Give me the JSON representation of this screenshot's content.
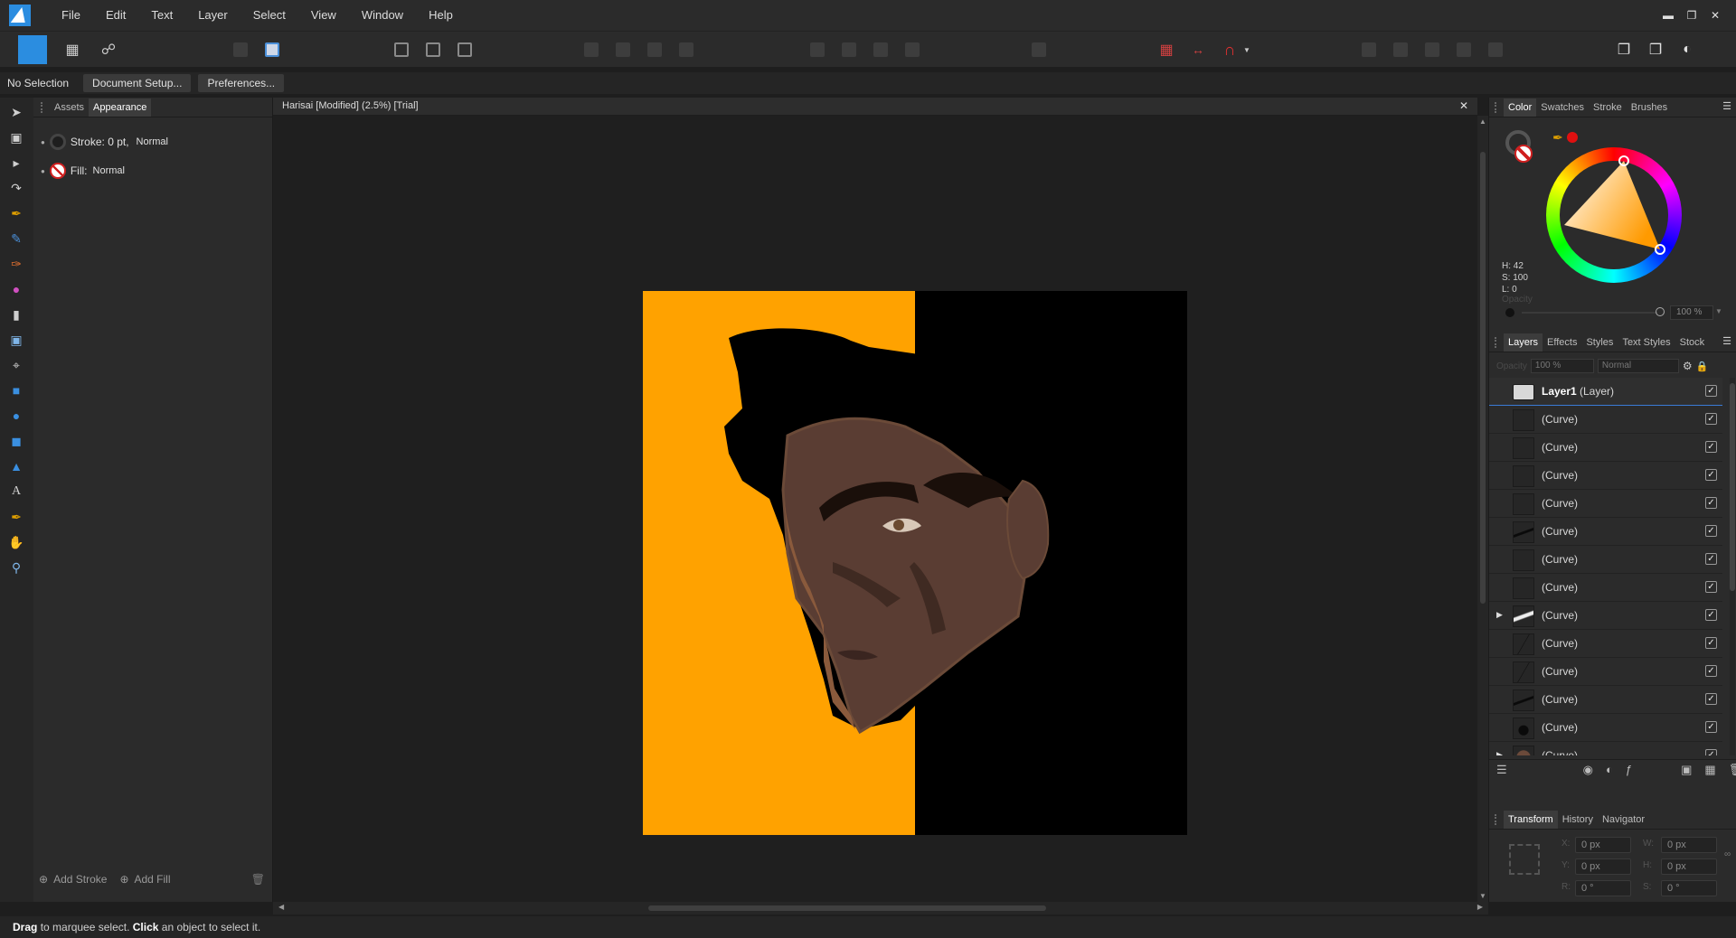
{
  "menubar": {
    "items": [
      "File",
      "Edit",
      "Text",
      "Layer",
      "Select",
      "View",
      "Window",
      "Help"
    ]
  },
  "context": {
    "label": "No Selection",
    "document_setup": "Document Setup...",
    "preferences": "Preferences..."
  },
  "left_panel": {
    "tabs": [
      "Assets",
      "Appearance"
    ],
    "stroke_label": "Stroke: 0 pt,",
    "stroke_mode": "Normal",
    "fill_label": "Fill:",
    "fill_mode": "Normal",
    "add_stroke": "Add Stroke",
    "add_fill": "Add Fill"
  },
  "document": {
    "title": "Harisai [Modified] (2.5%) [Trial]",
    "colors": {
      "orange": "#ffa200",
      "black": "#000000",
      "skin": "#5a3d33"
    }
  },
  "right_panel": {
    "top_tabs": [
      "Color",
      "Swatches",
      "Stroke",
      "Brushes"
    ],
    "hsl": {
      "h": "H: 42",
      "s": "S: 100",
      "l": "L: 0"
    },
    "opacity_label": "Opacity",
    "opacity_value": "100 %",
    "layer_tabs": [
      "Layers",
      "Effects",
      "Styles",
      "Text Styles",
      "Stock"
    ],
    "layer_opacity": "100 %",
    "blend_mode": "Normal",
    "layer_group": "Layer1",
    "layer_group_type": "(Layer)",
    "layers": [
      "(Curve)",
      "(Curve)",
      "(Curve)",
      "(Curve)",
      "(Curve)",
      "(Curve)",
      "(Curve)",
      "(Curve)",
      "(Curve)",
      "(Curve)",
      "(Curve)",
      "(Curve)",
      "(Curve)"
    ],
    "bottom_tabs": [
      "Transform",
      "History",
      "Navigator"
    ],
    "transform": {
      "x": "0 px",
      "y": "0 px",
      "w": "0 px",
      "h": "0 px",
      "r": "0 °",
      "s": "0 °"
    }
  },
  "status": {
    "drag": "Drag",
    "drag_text": "to marquee select.",
    "click": "Click",
    "click_text": "an object to select it."
  }
}
